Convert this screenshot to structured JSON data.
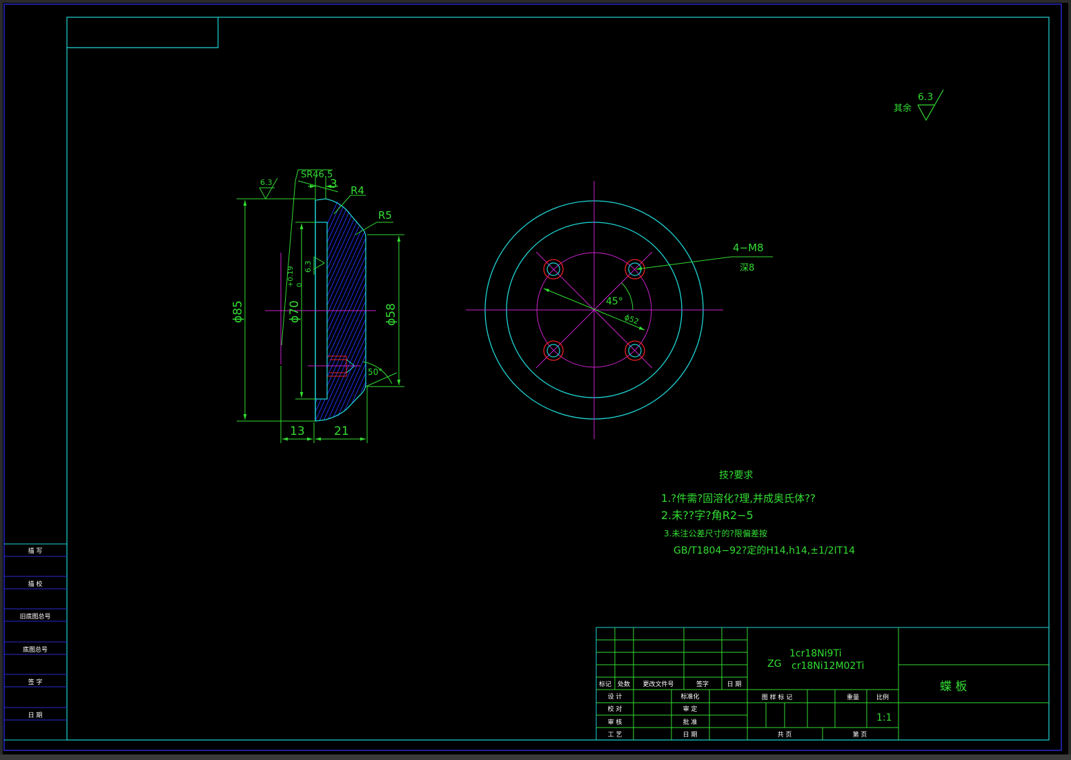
{
  "colors": {
    "background": "#000000",
    "frame": "#1fd6d6",
    "outer_frame": "#2a2ad0",
    "geometry": "#1fd6d6",
    "dimension": "#33dd33",
    "centerline": "#cc22cc",
    "hatch": "#2233ee",
    "hole_red": "#ee2222",
    "white_text": "#ffffff"
  },
  "roughness_note": {
    "label": "其余",
    "value": "6.3"
  },
  "side_view": {
    "sr_label": "SR46.5",
    "dim_3": "3",
    "r4_label": "R4",
    "r5_label": "R5",
    "roughness_top": "6.3",
    "roughness_inner": "6.3",
    "dia85": "ϕ85",
    "dia70": "ϕ70",
    "tol_upper": "+0.19",
    "tol_lower": "0",
    "dia58": "ϕ58",
    "angle50": "50°",
    "dim_13": "13",
    "dim_21": "21"
  },
  "front_view": {
    "holes_label": "4−M8",
    "depth_label": "深8",
    "angle_label": "45°",
    "pcd_label": "ϕ52"
  },
  "tech_requirements": {
    "title": "技?要求",
    "line1": "1.?件需?固溶化?理,并成奥氏体??",
    "line2": "2.未??字?角R2−5",
    "line3": "3.未注公差尺寸的?限偏差按",
    "line4": "GB/T1804−92?定的H14,h14,±1/2IT14"
  },
  "side_table": {
    "rows": [
      "描  写",
      "描  校",
      "旧底图总号",
      "底图总号",
      "签  字",
      "日  期"
    ]
  },
  "title_block": {
    "material_prefix": "ZG",
    "material_line1": "1cr18Ni9Ti",
    "material_line2": "cr18Ni12M02Ti",
    "part_name": "蝶      板",
    "rev_headers": [
      "标记",
      "处数",
      "更改文件号",
      "签字",
      "日 期"
    ],
    "sign_left": [
      "设 计",
      "校 对",
      "审 核",
      "工 艺"
    ],
    "sign_right": [
      "标准化",
      "审 定",
      "批 准",
      "日 期"
    ],
    "info_headers": {
      "mark": "图 样 标 记",
      "weight": "重量",
      "scale": "比例"
    },
    "scale_value": "1:1",
    "total_sheets": "共    页",
    "sheet_no": "第    页"
  }
}
